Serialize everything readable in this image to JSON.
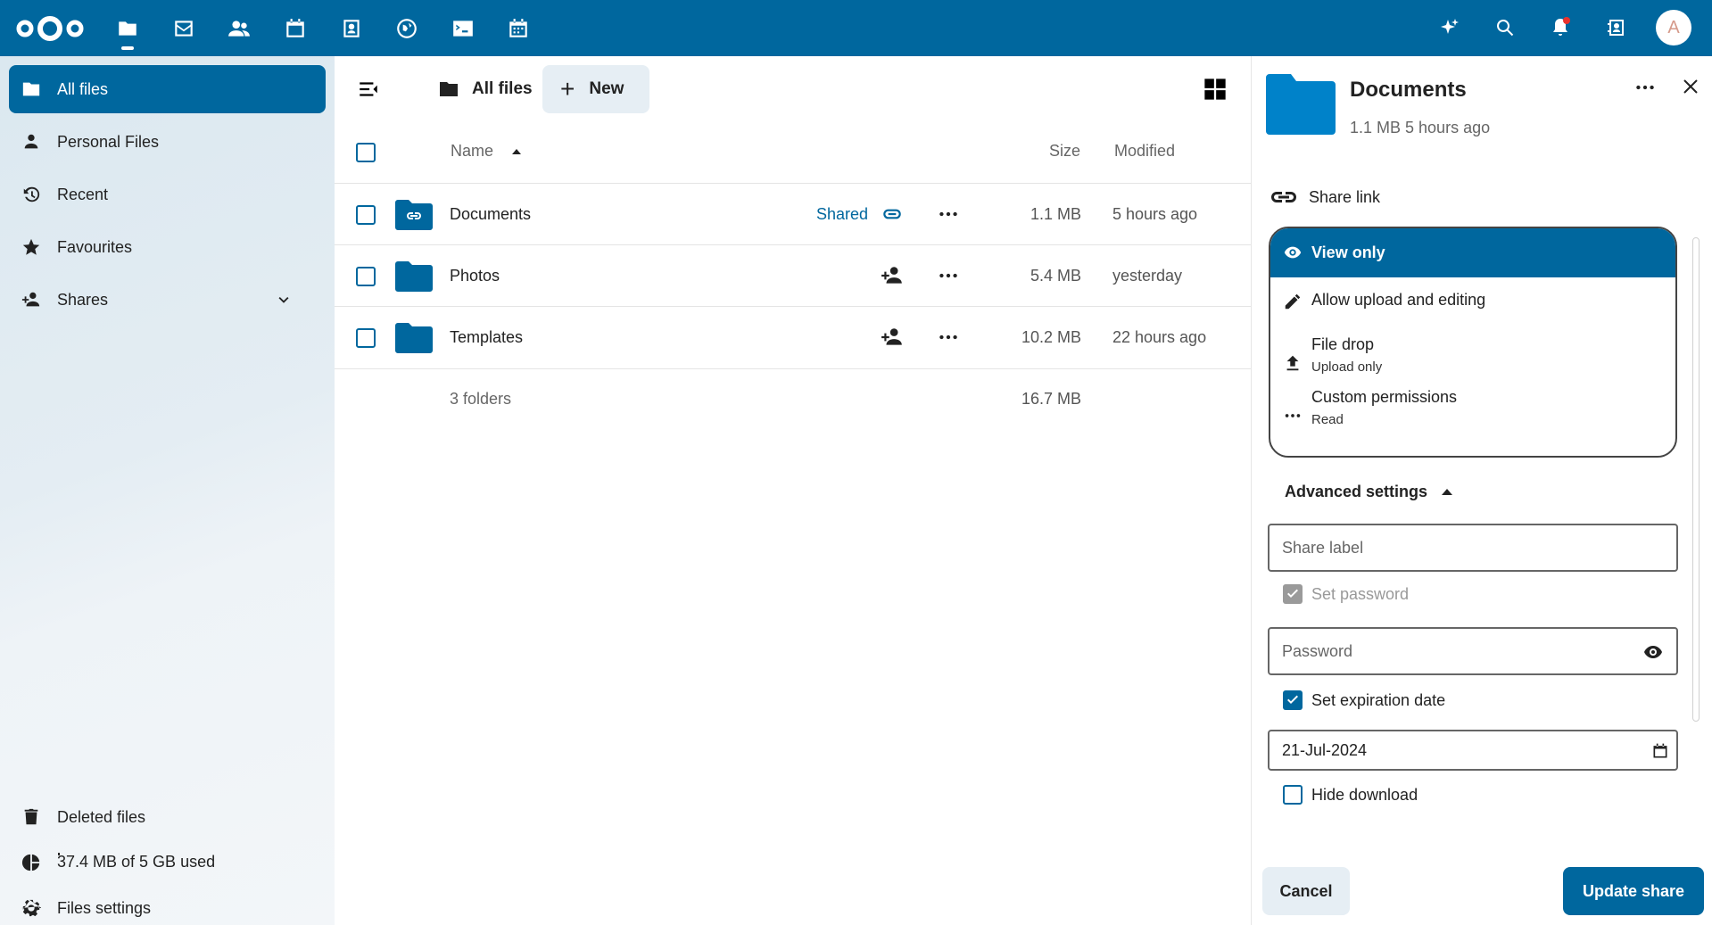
{
  "colors": {
    "primary": "#00679e",
    "header_bg": "#00679e",
    "notification": "#e9322d"
  },
  "header": {
    "logo": "nextcloud-logo",
    "apps": [
      "files-icon",
      "mail-icon",
      "contacts-icon",
      "calendar-icon",
      "photos-icon",
      "activity-icon",
      "terminal-icon",
      "deck-icon"
    ],
    "right_icons": [
      "assistant-icon",
      "search-icon",
      "notifications-icon",
      "contacts-menu-icon"
    ],
    "avatar_letter": "A"
  },
  "sidebar": {
    "items": [
      {
        "label": "All files",
        "icon": "folder-icon",
        "active": true
      },
      {
        "label": "Personal Files",
        "icon": "person-icon"
      },
      {
        "label": "Recent",
        "icon": "history-icon"
      },
      {
        "label": "Favourites",
        "icon": "star-icon"
      },
      {
        "label": "Shares",
        "icon": "share-icon"
      }
    ],
    "deleted": "Deleted files",
    "quota": "37.4 MB of 5 GB used",
    "settings": "Files settings"
  },
  "main": {
    "breadcrumb": "All files",
    "new_label": "New",
    "columns": {
      "name": "Name",
      "size": "Size",
      "modified": "Modified"
    },
    "rows": [
      {
        "name": "Documents",
        "shared_label": "Shared",
        "size": "1.1 MB",
        "modified": "5 hours ago"
      },
      {
        "name": "Photos",
        "size": "5.4 MB",
        "modified": "yesterday"
      },
      {
        "name": "Templates",
        "size": "10.2 MB",
        "modified": "22 hours ago"
      }
    ],
    "summary": {
      "count": "3 folders",
      "size": "16.7 MB"
    }
  },
  "panel": {
    "title": "Documents",
    "subtitle": "1.1 MB 5 hours ago",
    "share_link": "Share link",
    "permissions": {
      "selected": "View only",
      "options": [
        {
          "label": "Allow upload and editing",
          "sub": ""
        },
        {
          "label": "File drop",
          "sub": "Upload only"
        },
        {
          "label": "Custom permissions",
          "sub": "Read"
        }
      ]
    },
    "advanced": "Advanced settings",
    "share_label_placeholder": "Share label",
    "set_password": "Set password",
    "password_placeholder": "Password",
    "set_expiration": "Set expiration date",
    "expiration_value": "21-Jul-2024",
    "hide_download": "Hide download",
    "cancel": "Cancel",
    "update": "Update share"
  }
}
